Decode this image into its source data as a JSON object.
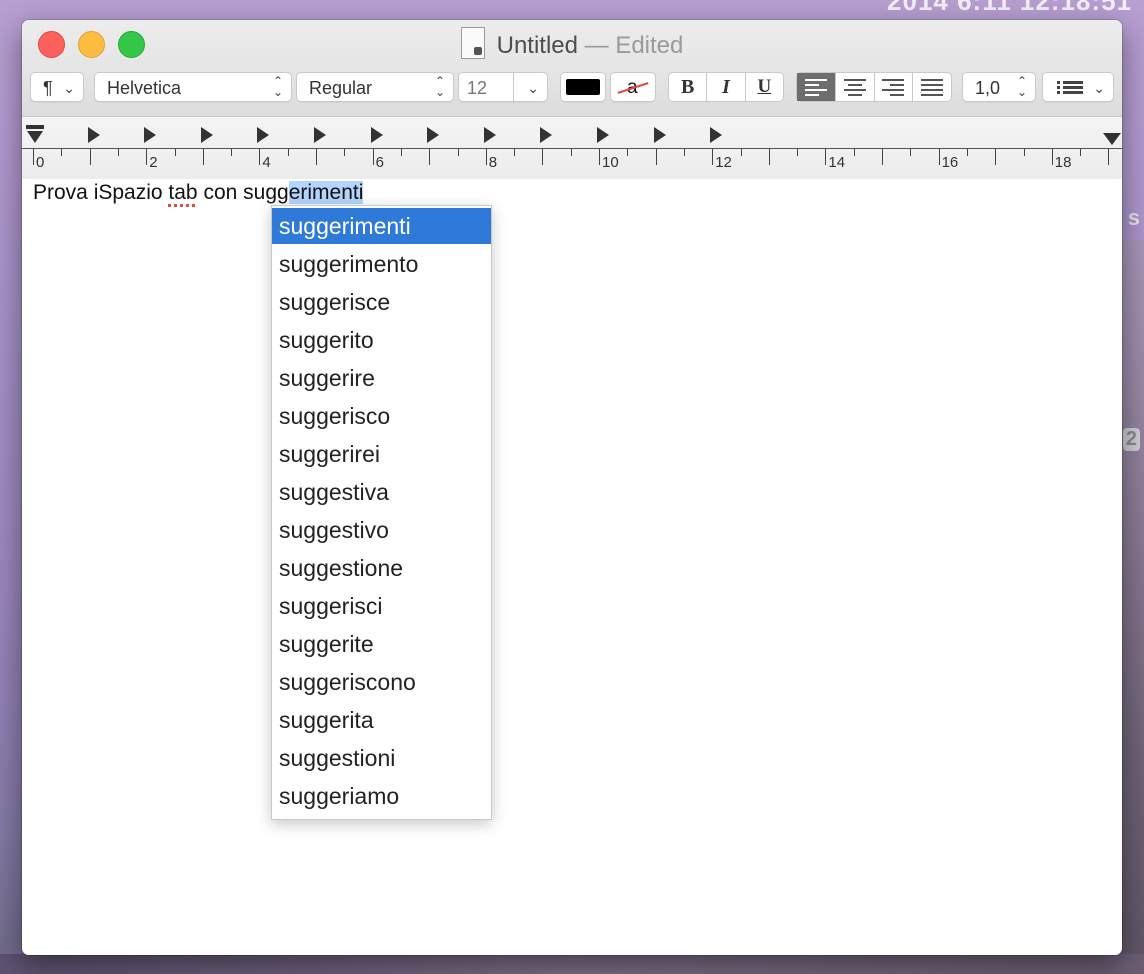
{
  "desktop": {
    "clock_text": "2014 6:11 12:18:51",
    "side_label_a": "s",
    "side_label_b": "2"
  },
  "window": {
    "title": "Untitled",
    "separator": "—",
    "status": "Edited",
    "toolbar": {
      "paragraph_icon": "¶",
      "font_family": "Helvetica",
      "font_style": "Regular",
      "font_size": "12",
      "text_color": "#000000",
      "highlight_glyph": "a",
      "bold": "B",
      "italic": "I",
      "underline": "U",
      "line_spacing": "1,0",
      "alignment_selected": "left"
    },
    "ruler": {
      "numbers": [
        "0",
        "2",
        "4",
        "6",
        "8",
        "10",
        "12",
        "14",
        "16",
        "18"
      ]
    },
    "document": {
      "text_before": "Prova iSpazio ",
      "misspelled_word": "tab",
      "text_middle": " con sugg",
      "selected_text": "erimenti"
    },
    "suggestions": {
      "selected_index": 0,
      "items": [
        "suggerimenti",
        "suggerimento",
        "suggerisce",
        "suggerito",
        "suggerire",
        "suggerisco",
        "suggerirei",
        "suggestiva",
        "suggestivo",
        "suggestione",
        "suggerisci",
        "suggerite",
        "suggeriscono",
        "suggerita",
        "suggestioni",
        "suggeriamo"
      ]
    }
  },
  "colors": {
    "selection_highlight": "#b3d4fc",
    "menu_selection": "#2f7ad9"
  }
}
